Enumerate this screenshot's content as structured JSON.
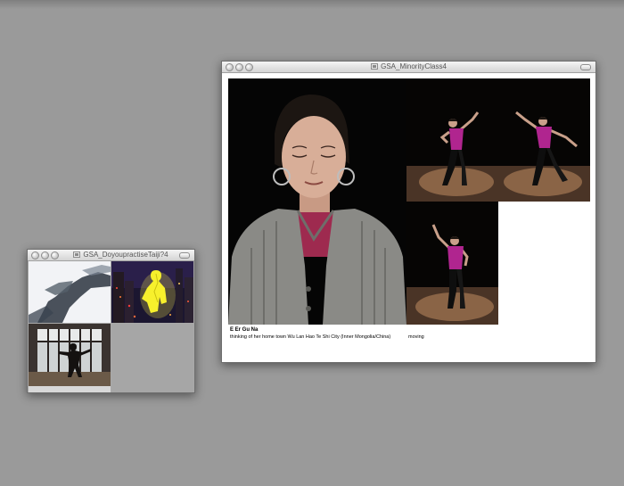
{
  "windows": {
    "small": {
      "title": "GSA_DoyoupractiseTaiji?4"
    },
    "large": {
      "title": "GSA_MinorityClass4",
      "caption": {
        "name": "E Er Gu Na",
        "description": "thinking of her home town Wu Lan Hao Te Shi City (Inner Mongolia/China)",
        "note": "moving"
      }
    }
  },
  "colors": {
    "desktop": "#9a9a9a",
    "dancer_shirt": "#b0258f",
    "photo_background": "#050505"
  }
}
